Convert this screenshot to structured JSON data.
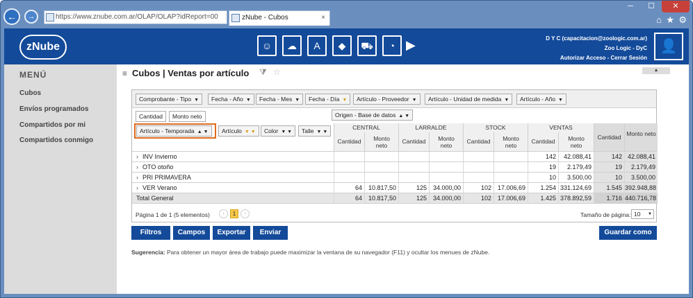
{
  "browser": {
    "url": "https://www.znube.com.ar/OLAP/OLAP?idReport=00",
    "tab_title": "zNube - Cubos",
    "tab_close": "×"
  },
  "header": {
    "logo": "zNube",
    "user_line1": "D Y C (capacitacion@zoologic.com.ar)",
    "user_line2": "Zoo Logic - DyC",
    "user_line3": "Autorizar Acceso - Cerrar Sesión"
  },
  "sidebar": {
    "title": "MENÚ",
    "items": [
      {
        "label": "Cubos"
      },
      {
        "label": "Envíos programados"
      },
      {
        "label": "Compartidos por mi"
      },
      {
        "label": "Compartidos conmigo"
      }
    ]
  },
  "page": {
    "title": "Cubos | Ventas por artículo"
  },
  "pivot": {
    "filter_fields": [
      "Comprobante - Tipo",
      "Fecha - Año",
      "Fecha - Mes",
      "Fecha - Día",
      "Artículo - Proveedor",
      "Artículo - Unidad de medida",
      "Artículo - Año"
    ],
    "data_fields": [
      "Cantidad",
      "Monto neto"
    ],
    "column_field": "Origen - Base de datos",
    "row_fields": [
      "Artículo - Temporada",
      "Artículo",
      "Color",
      "Talle"
    ],
    "column_groups": [
      "CENTRAL",
      "LARRALDE",
      "STOCK",
      "VENTAS"
    ],
    "sub_headers": [
      "Cantidad",
      "Monto neto"
    ],
    "grand_cantidad": "Cantidad",
    "grand_monto": "Monto neto",
    "rows": [
      {
        "label": "INV Invierno",
        "values": [
          "",
          "",
          "",
          "",
          "",
          "",
          "142",
          "42.088,41",
          "142",
          "42.088,41"
        ]
      },
      {
        "label": "OTO otoño",
        "values": [
          "",
          "",
          "",
          "",
          "",
          "",
          "19",
          "2.179,49",
          "19",
          "2.179,49"
        ]
      },
      {
        "label": "PRI PRIMAVERA",
        "values": [
          "",
          "",
          "",
          "",
          "",
          "",
          "10",
          "3.500,00",
          "10",
          "3.500,00"
        ]
      },
      {
        "label": "VER Verano",
        "values": [
          "64",
          "10.817,50",
          "125",
          "34.000,00",
          "102",
          "17.006,69",
          "1.254",
          "331.124,69",
          "1.545",
          "392.948,88"
        ]
      }
    ],
    "total": {
      "label": "Total General",
      "values": [
        "64",
        "10.817,50",
        "125",
        "34.000,00",
        "102",
        "17.006,69",
        "1.425",
        "378.892,59",
        "1.716",
        "440.716,78"
      ]
    },
    "pager_text": "Página 1 de 1 (5 elementos)",
    "current_page": "1",
    "page_size_label": "Tamaño de página:",
    "page_size": "10"
  },
  "buttons": {
    "filtros": "Filtros",
    "campos": "Campos",
    "exportar": "Exportar",
    "enviar": "Enviar",
    "guardar": "Guardar como"
  },
  "suggestion": {
    "bold": "Sugerencia:",
    "text": " Para obtener un mayor área de trabajo puede maximizar la ventana de su navegador (F11) y ocultar los menues de zNube."
  },
  "colors": {
    "brand": "#134a9a",
    "highlight": "#e06a1a"
  }
}
